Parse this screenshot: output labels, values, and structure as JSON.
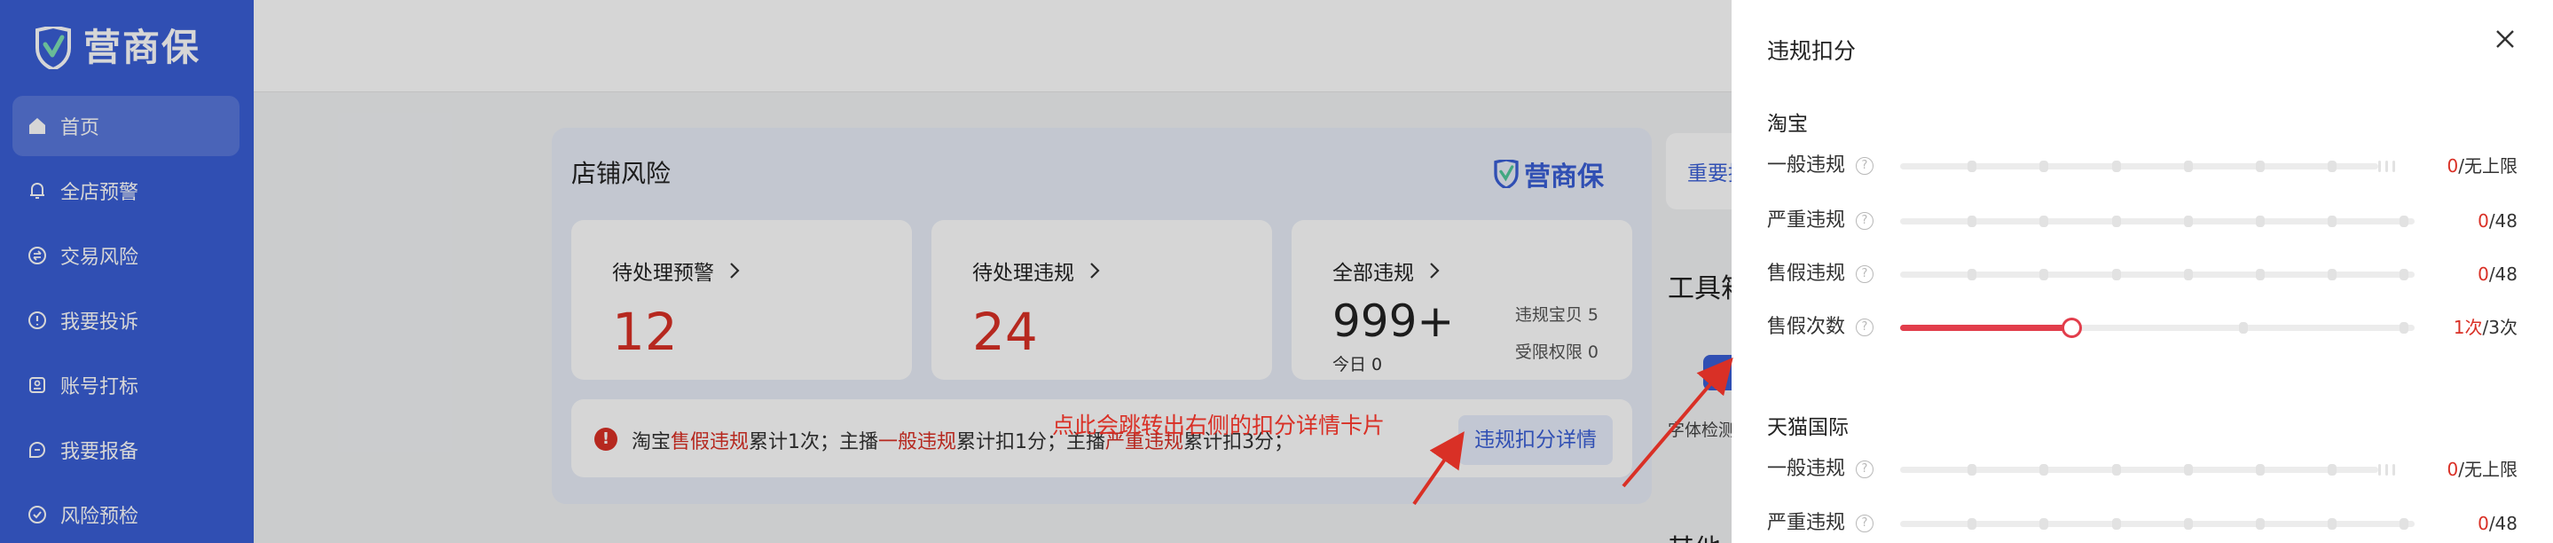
{
  "app": {
    "logo_text": "营商保",
    "brand_color": "#3a5fd6",
    "danger_color": "#d93026"
  },
  "sidebar": {
    "items": [
      {
        "label": "首页",
        "icon": "home-icon",
        "active": true
      },
      {
        "label": "全店预警",
        "icon": "bell-icon"
      },
      {
        "label": "交易风险",
        "icon": "exchange-icon"
      },
      {
        "label": "我要投诉",
        "icon": "alert-circle-icon"
      },
      {
        "label": "账号打标",
        "icon": "tag-card-icon"
      },
      {
        "label": "我要报备",
        "icon": "report-icon"
      },
      {
        "label": "风险预检",
        "icon": "shield-check-icon"
      }
    ]
  },
  "main": {
    "store_risk": {
      "title": "店铺风险",
      "brand_text": "营商保",
      "stats": [
        {
          "label": "待处理预警",
          "value": "12"
        },
        {
          "label": "待处理违规",
          "value": "24"
        },
        {
          "label": "全部违规",
          "value": "999+",
          "sub": "今日 0",
          "side": [
            "违规宝贝 5",
            "受限权限 0"
          ]
        }
      ],
      "notice": {
        "parts": [
          {
            "text": "淘宝",
            "red": false
          },
          {
            "text": "售假违规",
            "red": true
          },
          {
            "text": "累计1次；主播",
            "red": false
          },
          {
            "text": "一般违规",
            "red": true
          },
          {
            "text": "累计扣1分；主播",
            "red": false
          },
          {
            "text": "严重违规",
            "red": true
          },
          {
            "text": "累计扣3分；",
            "red": false
          }
        ],
        "button": "违规扣分详情"
      }
    },
    "side_card_text": "重要提",
    "tools_title": "工具箱",
    "tool_label": "字体检测",
    "other_title": "其他",
    "callout": "点此会跳转出右侧的扣分详情卡片"
  },
  "drawer": {
    "title": "违规扣分",
    "sections": [
      {
        "title": "淘宝",
        "rules": [
          {
            "label": "一般违规",
            "current": "0",
            "limit": "/无上限",
            "progress": 0,
            "ticks": [
              0.14,
              0.28,
              0.42,
              0.56,
              0.7,
              0.84
            ],
            "unlimited": true
          },
          {
            "label": "严重违规",
            "current": "0",
            "limit": "/48",
            "progress": 0,
            "ticks": [
              0.14,
              0.28,
              0.42,
              0.56,
              0.7,
              0.84,
              0.98
            ]
          },
          {
            "label": "售假违规",
            "current": "0",
            "limit": "/48",
            "progress": 0,
            "ticks": [
              0.14,
              0.28,
              0.42,
              0.56,
              0.7,
              0.84,
              0.98
            ]
          },
          {
            "label": "售假次数",
            "current": "1次",
            "limit": "/3次",
            "progress": 0.333,
            "ticks": [
              0.667,
              0.98
            ]
          }
        ]
      },
      {
        "title": "天猫国际",
        "rules": [
          {
            "label": "一般违规",
            "current": "0",
            "limit": "/无上限",
            "progress": 0,
            "ticks": [
              0.14,
              0.28,
              0.42,
              0.56,
              0.7,
              0.84
            ],
            "unlimited": true
          },
          {
            "label": "严重违规",
            "current": "0",
            "limit": "/48",
            "progress": 0,
            "ticks": [
              0.14,
              0.28,
              0.42,
              0.56,
              0.7,
              0.84,
              0.98
            ]
          }
        ]
      }
    ]
  }
}
